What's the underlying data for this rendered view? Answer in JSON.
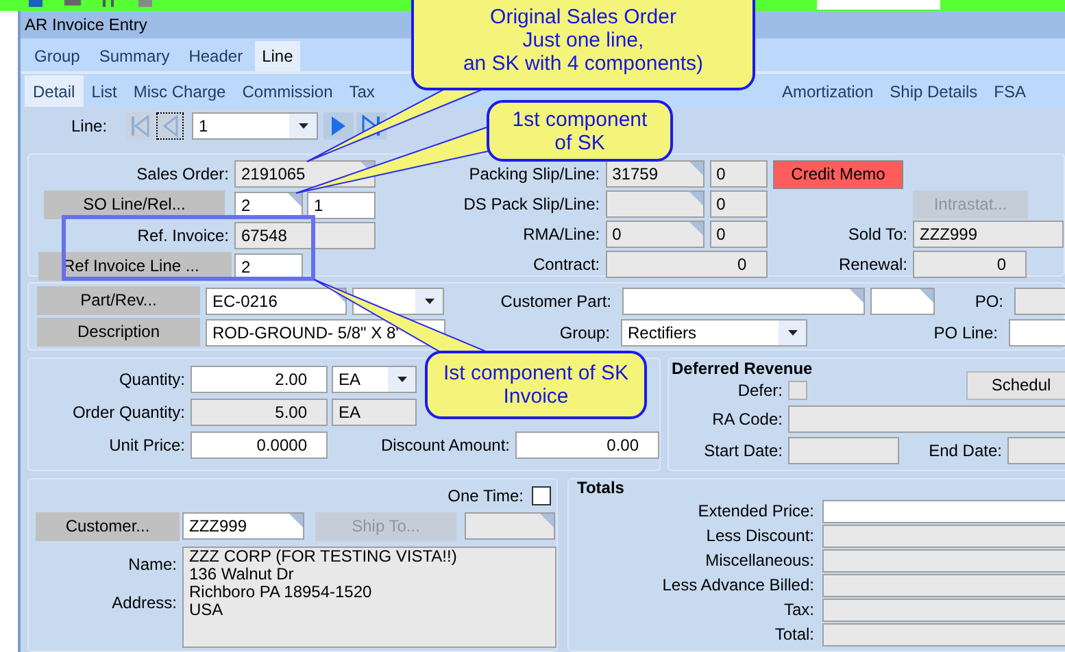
{
  "window": {
    "title": "AR Invoice Entry"
  },
  "main_tabs": [
    {
      "label": "Group",
      "selected": false
    },
    {
      "label": "Summary",
      "selected": false
    },
    {
      "label": "Header",
      "selected": false
    },
    {
      "label": "Line",
      "selected": true
    }
  ],
  "sub_tabs": [
    {
      "label": "Detail",
      "selected": true
    },
    {
      "label": "List",
      "selected": false
    },
    {
      "label": "Misc Charge",
      "selected": false
    },
    {
      "label": "Commission",
      "selected": false
    },
    {
      "label": "Tax",
      "selected": false
    },
    {
      "label": "Amortization",
      "selected": false
    },
    {
      "label": "Ship Details",
      "selected": false
    },
    {
      "label": "FSA",
      "selected": false
    }
  ],
  "line_nav": {
    "label": "Line:",
    "value": "1",
    "buttons": [
      {
        "kind": "first",
        "disabled": true
      },
      {
        "kind": "previous",
        "disabled": true
      },
      {
        "kind": "next",
        "disabled": false
      },
      {
        "kind": "last",
        "disabled": false
      }
    ]
  },
  "order_panel": {
    "sales_order": {
      "label": "Sales Order:",
      "field": {
        "value": "2191065",
        "kind": "readonly",
        "lookup": true
      }
    },
    "so_line": {
      "button": {
        "label": "SO Line/Rel...",
        "kind": "flat",
        "disabled": false
      },
      "line": {
        "value": "2",
        "kind": "editable",
        "lookup": true
      },
      "release": {
        "value": "1",
        "kind": "editable"
      }
    },
    "ref_invoice": {
      "label": "Ref. Invoice:",
      "field": {
        "value": "67548",
        "kind": "readonly"
      }
    },
    "ref_invoice_line": {
      "button": {
        "label": "Ref Invoice Line ...",
        "kind": "flat",
        "disabled": false
      },
      "field": {
        "value": "2",
        "kind": "editable"
      }
    },
    "packing_slip": {
      "label": "Packing Slip/Line:",
      "slip": {
        "value": "31759",
        "kind": "readonly",
        "lookup": true
      },
      "line": {
        "value": "0",
        "kind": "readonly"
      }
    },
    "ds_pack_slip": {
      "label": "DS Pack Slip/Line:",
      "slip": {
        "kind": "readonly",
        "lookup": true
      },
      "line": {
        "value": "0",
        "kind": "readonly"
      }
    },
    "rma": {
      "label": "RMA/Line:",
      "rma": {
        "value": "0",
        "kind": "readonly",
        "lookup": true
      },
      "line": {
        "value": "0",
        "kind": "readonly"
      }
    },
    "contract": {
      "label": "Contract:",
      "field": {
        "value": "0",
        "kind": "readonly"
      }
    },
    "credit_memo_button": {
      "label": "Credit Memo",
      "kind": "alert",
      "disabled": false
    },
    "intrastat_button": {
      "label": "Intrastat...",
      "kind": "flat",
      "disabled": true
    },
    "sold_to": {
      "label": "Sold To:",
      "field": {
        "value": "ZZZ999",
        "kind": "readonly"
      }
    },
    "renewal": {
      "label": "Renewal:",
      "field": {
        "value": "0",
        "kind": "readonly"
      }
    }
  },
  "part_panel": {
    "part_button": {
      "label": "Part/Rev...",
      "kind": "flat",
      "disabled": false
    },
    "part": {
      "value": "EC-0216",
      "kind": "editable",
      "lookup": true
    },
    "revision": {
      "kind": "editable"
    },
    "description_button": {
      "label": "Description",
      "kind": "flat",
      "disabled": false
    },
    "description": {
      "value": "ROD-GROUND- 5/8\" X 8'",
      "kind": "editable"
    },
    "customer_part": {
      "label": "Customer Part:",
      "part": {
        "kind": "editable",
        "lookup": true
      },
      "revision": {
        "kind": "editable",
        "lookup": true
      }
    },
    "group": {
      "label": "Group:",
      "field": {
        "value": "Rectifiers",
        "kind": "editable"
      }
    },
    "po": {
      "label": "PO:",
      "field": {
        "kind": "readonly"
      }
    },
    "po_line": {
      "label": "PO Line:",
      "field": {
        "kind": "editable"
      }
    }
  },
  "quantity_panel": {
    "quantity": {
      "label": "Quantity:",
      "field": {
        "value": "2.00",
        "kind": "editable"
      },
      "unit": {
        "value": "EA",
        "kind": "editable"
      }
    },
    "order_quantity": {
      "label": "Order Quantity:",
      "field": {
        "value": "5.00",
        "kind": "readonly"
      },
      "unit": {
        "value": "EA",
        "kind": "readonly"
      }
    },
    "unit_price": {
      "label": "Unit Price:",
      "field": {
        "value": "0.0000",
        "kind": "editable"
      }
    },
    "discount_amount": {
      "label": "Discount Amount:",
      "field": {
        "value": "0.00",
        "kind": "editable"
      }
    }
  },
  "deferred_revenue": {
    "title": "Deferred Revenue",
    "defer": {
      "label": "Defer:",
      "checked": false,
      "disabled": true
    },
    "schedule_button": {
      "label": "Schedul",
      "kind": "raised",
      "disabled": false
    },
    "ra_code": {
      "label": "RA Code:",
      "field": {
        "kind": "readonly"
      }
    },
    "start_date": {
      "label": "Start Date:",
      "field": {
        "kind": "readonly"
      }
    },
    "end_date": {
      "label": "End Date:",
      "field": {
        "kind": "readonly"
      }
    }
  },
  "customer_panel": {
    "one_time": {
      "label": "One Time:",
      "checked": false,
      "disabled": false
    },
    "customer_button": {
      "label": "Customer...",
      "kind": "flat",
      "disabled": false
    },
    "customer": {
      "value": "ZZZ999",
      "kind": "editable",
      "lookup": true
    },
    "ship_to_button": {
      "label": "Ship To...",
      "kind": "flat",
      "disabled": true
    },
    "ship_to": {
      "kind": "readonly",
      "lookup": true
    },
    "name_label": "Name:",
    "address_label": "Address:",
    "address": {
      "value": "ZZZ CORP (FOR TESTING VISTA!!)\n136 Walnut Dr\nRichboro PA 18954-1520\nUSA",
      "kind": "readonly"
    }
  },
  "totals": {
    "title": "Totals",
    "rows": [
      {
        "label": "Extended Price:",
        "kind": "editable"
      },
      {
        "label": "Less Discount:",
        "kind": "readonly"
      },
      {
        "label": "Miscellaneous:",
        "kind": "readonly"
      },
      {
        "label": "Less Advance Billed:",
        "kind": "readonly"
      },
      {
        "label": "Tax:",
        "kind": "readonly"
      },
      {
        "label": "Total:",
        "kind": "readonly"
      }
    ]
  },
  "callouts": [
    {
      "text": "Original Sales Order\nJust one line,\nan SK with 4 components)"
    },
    {
      "text": "1st component\nof SK"
    },
    {
      "text": "Ist component of SK\nInvoice"
    }
  ]
}
